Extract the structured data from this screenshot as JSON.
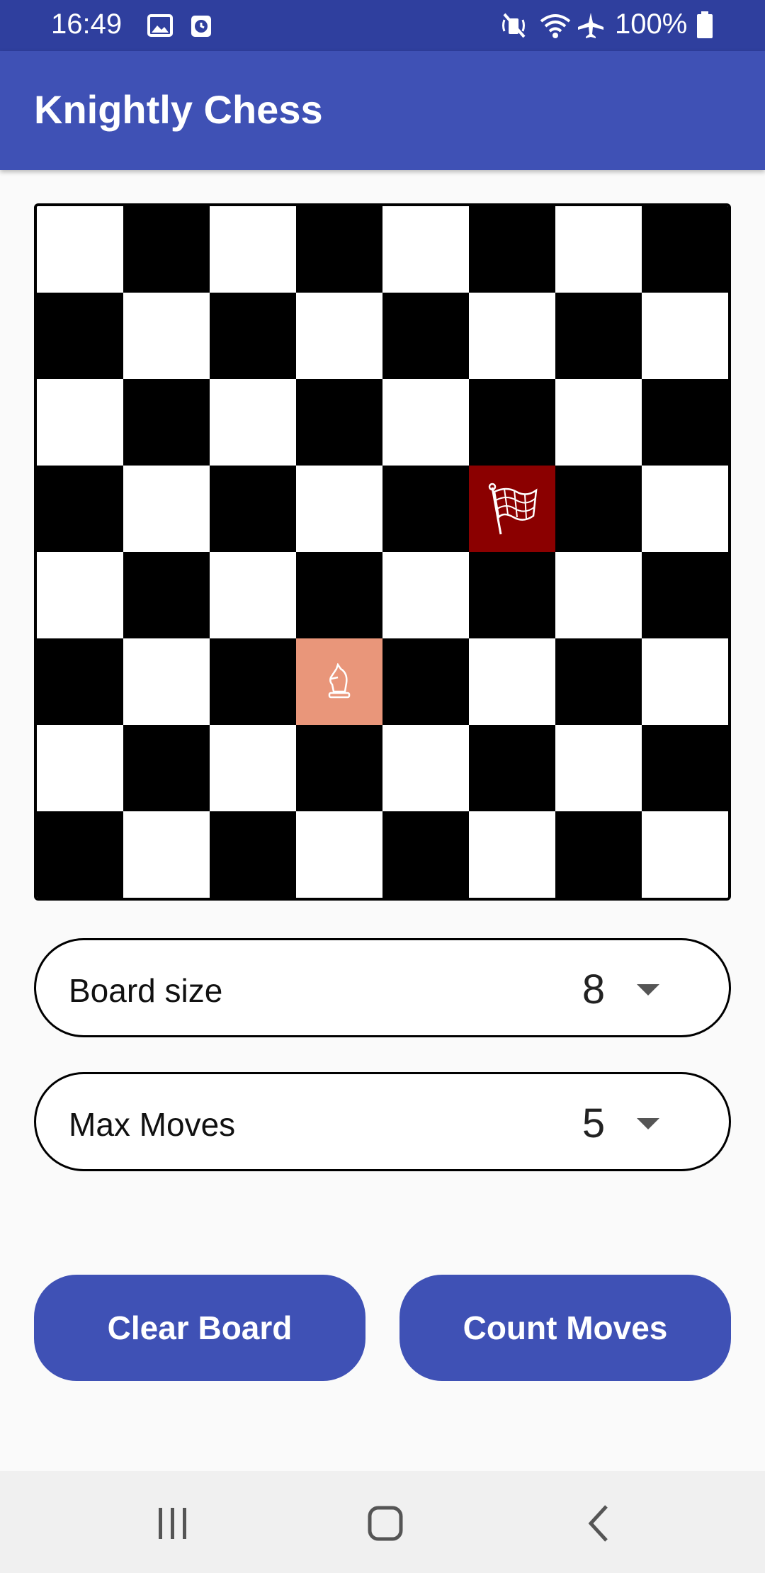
{
  "status_bar": {
    "time": "16:49",
    "battery": "100%",
    "icons": [
      "image-icon",
      "alarm-app-icon",
      "mute-icon",
      "wifi-icon",
      "airplane-icon",
      "battery-icon"
    ]
  },
  "app_bar": {
    "title": "Knightly Chess"
  },
  "board": {
    "size": 8,
    "knight_icon": "chess-knight-icon",
    "flag_icon": "checkered-flag-icon",
    "colors": {
      "light": "#ffffff",
      "dark": "#000000",
      "start": "#e9967a",
      "target": "#8b0000"
    }
  },
  "board_size_selector": {
    "label": "Board size",
    "value": "8"
  },
  "max_moves_selector": {
    "label": "Max Moves",
    "value": "5"
  },
  "buttons": {
    "clear": "Clear Board",
    "count": "Count Moves"
  },
  "colors": {
    "primary": "#3f51b5",
    "status_bar": "#2f3f9e"
  },
  "nav_bar": {
    "icons": [
      "recent-apps-icon",
      "home-icon",
      "back-icon"
    ]
  }
}
